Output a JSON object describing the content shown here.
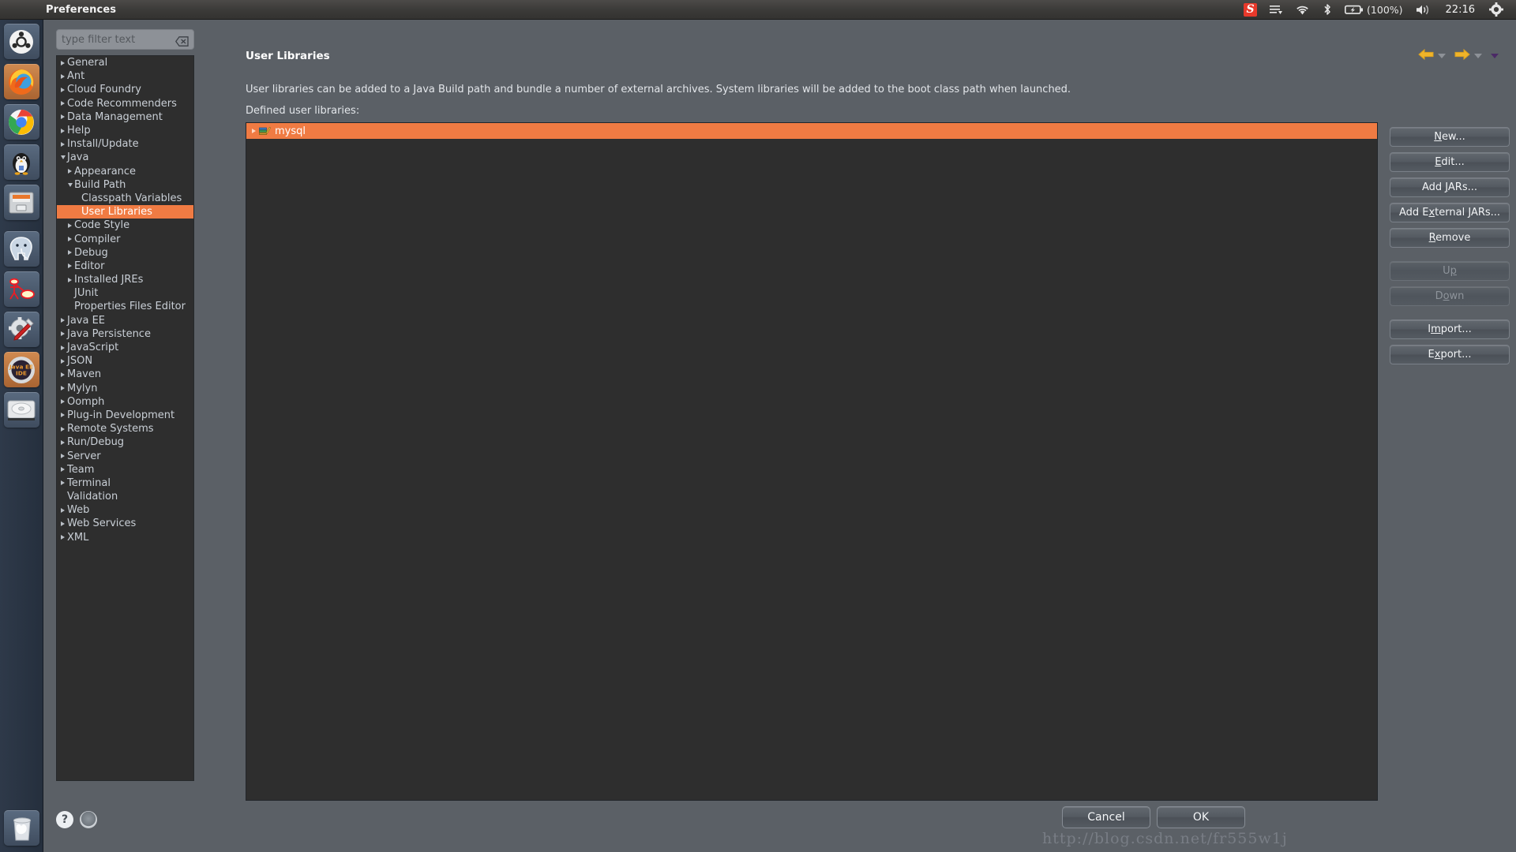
{
  "top_panel": {
    "title": "Preferences",
    "tray": {
      "sogou_label": "S",
      "menu_icon": "hamburger-menu-icon",
      "wifi_icon": "wifi-icon",
      "bluetooth_icon": "bluetooth-icon",
      "battery_icon": "battery-icon",
      "battery_label": "(100%)",
      "volume_icon": "volume-icon",
      "clock": "22:16",
      "gear_icon": "system-gear-icon"
    }
  },
  "launcher": {
    "items": [
      {
        "name": "ubuntu-dash",
        "label": "Ubuntu Dash"
      },
      {
        "name": "firefox",
        "label": "Firefox"
      },
      {
        "name": "chrome",
        "label": "Google Chrome"
      },
      {
        "name": "qq",
        "label": "QQ"
      },
      {
        "name": "files",
        "label": "Files"
      },
      {
        "name": "postgresql",
        "label": "PostgreSQL"
      },
      {
        "name": "uml-tool",
        "label": "UML Tool"
      },
      {
        "name": "settings",
        "label": "System Settings"
      },
      {
        "name": "eclipse-java-ee-ide",
        "label": "Java EE IDE"
      },
      {
        "name": "disk-utility",
        "label": "Disk Utility"
      }
    ],
    "eclipse_label_line1": "Java EE",
    "eclipse_label_line2": "IDE",
    "trash": {
      "name": "trash",
      "label": "Trash"
    }
  },
  "filter": {
    "placeholder": "type filter text",
    "value": "",
    "clear_icon": "clear-field-icon"
  },
  "tree": [
    {
      "label": "General",
      "depth": 0,
      "state": "closed"
    },
    {
      "label": "Ant",
      "depth": 0,
      "state": "closed"
    },
    {
      "label": "Cloud Foundry",
      "depth": 0,
      "state": "closed"
    },
    {
      "label": "Code Recommenders",
      "depth": 0,
      "state": "closed"
    },
    {
      "label": "Data Management",
      "depth": 0,
      "state": "closed"
    },
    {
      "label": "Help",
      "depth": 0,
      "state": "closed"
    },
    {
      "label": "Install/Update",
      "depth": 0,
      "state": "closed"
    },
    {
      "label": "Java",
      "depth": 0,
      "state": "open"
    },
    {
      "label": "Appearance",
      "depth": 1,
      "state": "closed"
    },
    {
      "label": "Build Path",
      "depth": 1,
      "state": "open"
    },
    {
      "label": "Classpath Variables",
      "depth": 2,
      "state": "leaf"
    },
    {
      "label": "User Libraries",
      "depth": 2,
      "state": "leaf",
      "selected": true
    },
    {
      "label": "Code Style",
      "depth": 1,
      "state": "closed"
    },
    {
      "label": "Compiler",
      "depth": 1,
      "state": "closed"
    },
    {
      "label": "Debug",
      "depth": 1,
      "state": "closed"
    },
    {
      "label": "Editor",
      "depth": 1,
      "state": "closed"
    },
    {
      "label": "Installed JREs",
      "depth": 1,
      "state": "closed"
    },
    {
      "label": "JUnit",
      "depth": 1,
      "state": "leaf"
    },
    {
      "label": "Properties Files Editor",
      "depth": 1,
      "state": "leaf"
    },
    {
      "label": "Java EE",
      "depth": 0,
      "state": "closed"
    },
    {
      "label": "Java Persistence",
      "depth": 0,
      "state": "closed"
    },
    {
      "label": "JavaScript",
      "depth": 0,
      "state": "closed"
    },
    {
      "label": "JSON",
      "depth": 0,
      "state": "closed"
    },
    {
      "label": "Maven",
      "depth": 0,
      "state": "closed"
    },
    {
      "label": "Mylyn",
      "depth": 0,
      "state": "closed"
    },
    {
      "label": "Oomph",
      "depth": 0,
      "state": "closed"
    },
    {
      "label": "Plug-in Development",
      "depth": 0,
      "state": "closed"
    },
    {
      "label": "Remote Systems",
      "depth": 0,
      "state": "closed"
    },
    {
      "label": "Run/Debug",
      "depth": 0,
      "state": "closed"
    },
    {
      "label": "Server",
      "depth": 0,
      "state": "closed"
    },
    {
      "label": "Team",
      "depth": 0,
      "state": "closed"
    },
    {
      "label": "Terminal",
      "depth": 0,
      "state": "closed"
    },
    {
      "label": "Validation",
      "depth": 0,
      "state": "leaf"
    },
    {
      "label": "Web",
      "depth": 0,
      "state": "closed"
    },
    {
      "label": "Web Services",
      "depth": 0,
      "state": "closed"
    },
    {
      "label": "XML",
      "depth": 0,
      "state": "closed"
    }
  ],
  "content": {
    "page_title": "User Libraries",
    "description": "User libraries can be added to a Java Build path and bundle a number of external archives. System libraries will be added to the boot class path when launched.",
    "sub_label": "Defined user libraries:",
    "nav": {
      "back_icon": "back-arrow-icon",
      "back_menu_icon": "chevron-down-icon",
      "forward_icon": "forward-arrow-icon",
      "forward_menu_icon": "chevron-down-icon",
      "view_menu_icon": "chevron-down-icon"
    },
    "libraries": [
      {
        "name": "mysql",
        "icon": "user-library-icon",
        "selected": true
      }
    ],
    "buttons": [
      {
        "id": "new",
        "pre": "",
        "mn": "N",
        "post": "ew...",
        "enabled": true,
        "spacer": false
      },
      {
        "id": "edit",
        "pre": "",
        "mn": "E",
        "post": "dit...",
        "enabled": true,
        "spacer": false
      },
      {
        "id": "add-jars",
        "pre": "Add ",
        "mn": "J",
        "post": "ARs...",
        "enabled": true,
        "spacer": false
      },
      {
        "id": "add-external-jars",
        "pre": "Add E",
        "mn": "x",
        "post": "ternal JARs...",
        "enabled": true,
        "spacer": false
      },
      {
        "id": "remove",
        "pre": "",
        "mn": "R",
        "post": "emove",
        "enabled": true,
        "spacer": false
      },
      {
        "id": "up",
        "pre": "U",
        "mn": "p",
        "post": "",
        "enabled": false,
        "spacer": true
      },
      {
        "id": "down",
        "pre": "D",
        "mn": "o",
        "post": "wn",
        "enabled": false,
        "spacer": false
      },
      {
        "id": "import",
        "pre": "I",
        "mn": "m",
        "post": "port...",
        "enabled": true,
        "spacer": true
      },
      {
        "id": "export",
        "pre": "E",
        "mn": "x",
        "post": "port...",
        "enabled": true,
        "spacer": false
      }
    ]
  },
  "footer": {
    "help_label": "?",
    "help_icon": "help-question-icon",
    "config_icon": "configure-icon",
    "cancel_label": "Cancel",
    "ok_label": "OK",
    "watermark": "http://blog.csdn.net/fr555w1j"
  },
  "colors": {
    "selection_orange": "#f07b43",
    "panel_gray": "#5b6066",
    "list_bg": "#2e2e2e",
    "text_light": "#e3e6ea"
  }
}
